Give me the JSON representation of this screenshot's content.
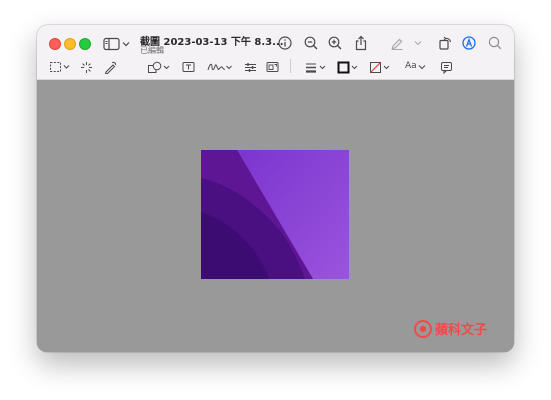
{
  "window": {
    "title": "截圖 2023-03-13 下午 8.3...",
    "subtitle": "已編輯"
  },
  "toolbar": {
    "text_style_label": "Aa"
  },
  "icons": {
    "sidebar": "sidebar-icon",
    "info": "info-icon",
    "zoom_out": "zoom-out-icon",
    "zoom_in": "zoom-in-icon",
    "share": "share-icon",
    "markup_highlight": "highlighter-icon",
    "rotate": "rotate-icon",
    "markup": "markup-icon",
    "search": "search-icon",
    "rect_selection": "rectangle-selection-icon",
    "instant_alpha": "instant-alpha-icon",
    "sketch": "sketch-icon",
    "shapes": "shapes-icon",
    "textbox": "text-box-icon",
    "sign": "signature-icon",
    "adjust_color": "adjust-color-icon",
    "adjust_size": "adjust-size-icon",
    "border_style": "border-style-icon",
    "border_color": "border-color-icon",
    "fill_color": "fill-color-icon",
    "note": "note-icon"
  },
  "watermark": {
    "logo": "蘋科文子"
  },
  "colors": {
    "canvas": "#999999",
    "titlebar": "#f4f2f4",
    "accent": "#1a6ef5",
    "watermark": "#ef4b4b",
    "art_primary": "#6b22b8",
    "art_dark": "#3b0c78",
    "art_light": "#8a45d6"
  }
}
